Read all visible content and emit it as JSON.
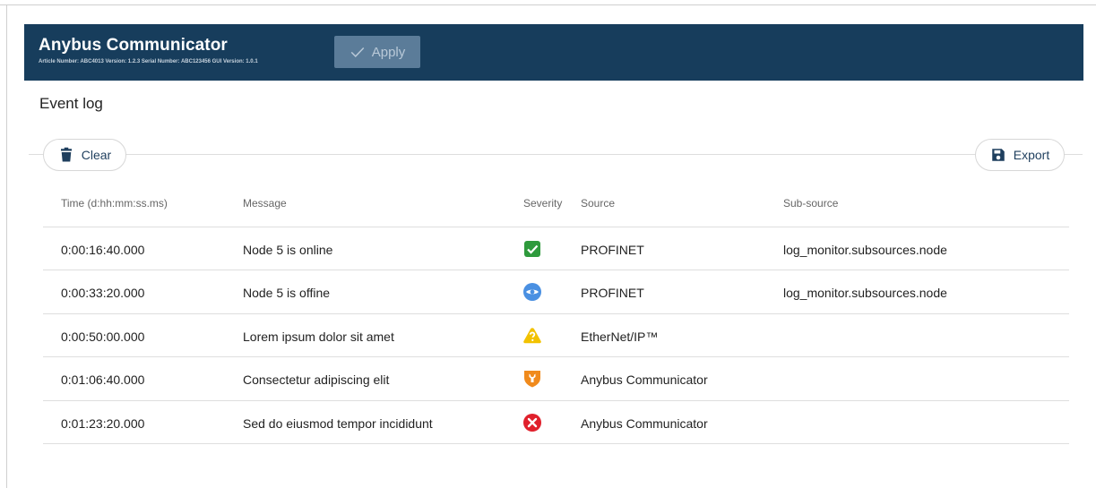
{
  "header": {
    "title": "Anybus Communicator",
    "meta": "Article Number: ABC4013 Version: 1.2.3 Serial Number: ABC123456 GUI Version: 1.0.1",
    "apply_label": "Apply"
  },
  "page": {
    "title": "Event log"
  },
  "toolbar": {
    "clear_label": "Clear",
    "export_label": "Export"
  },
  "table": {
    "columns": [
      "Time (d:hh:mm:ss.ms)",
      "Message",
      "Severity",
      "Source",
      "Sub-source"
    ],
    "rows": [
      {
        "time": "0:00:16:40.000",
        "message": "Node 5 is online",
        "severity": "success-check-icon",
        "source": "PROFINET",
        "subsource": "log_monitor.subsources.node"
      },
      {
        "time": "0:00:33:20.000",
        "message": "Node 5 is offine",
        "severity": "info-eye-icon",
        "source": "PROFINET",
        "subsource": "log_monitor.subsources.node"
      },
      {
        "time": "0:00:50:00.000",
        "message": "Lorem ipsum dolor sit amet",
        "severity": "warning-triangle-icon",
        "source": "EtherNet/IP™",
        "subsource": ""
      },
      {
        "time": "0:01:06:40.000",
        "message": "Consectetur adipiscing elit",
        "severity": "wrench-shield-icon",
        "source": "Anybus Communicator",
        "subsource": ""
      },
      {
        "time": "0:01:23:20.000",
        "message": "Sed do eiusmod tempor incididunt",
        "severity": "error-circle-icon",
        "source": "Anybus Communicator",
        "subsource": ""
      }
    ]
  },
  "colors": {
    "header_bg": "#173d5c",
    "success": "#2e9a3c",
    "info": "#4a90e2",
    "warning": "#f2c200",
    "tool": "#f08a1c",
    "error": "#e0202c"
  }
}
